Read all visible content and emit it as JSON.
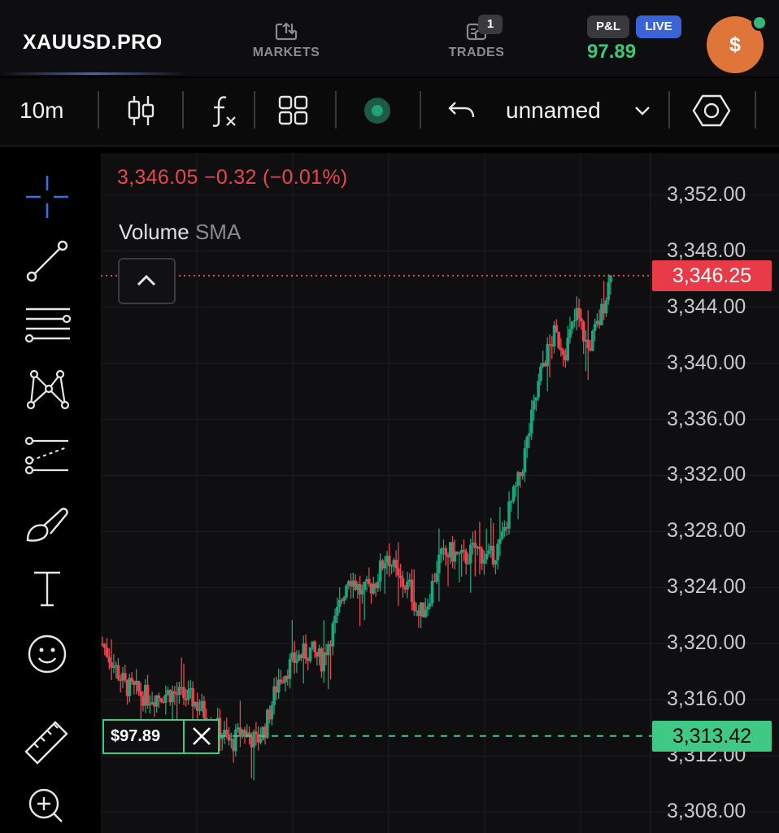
{
  "header": {
    "brand": "XAUUSD.PRO",
    "nav": [
      {
        "label": "MARKETS",
        "icon": "markets-icon"
      },
      {
        "label": "TRADES",
        "icon": "trades-icon",
        "badge": "1"
      }
    ],
    "pnl_label": "P&L",
    "live_label": "LIVE",
    "pnl_value": "97.89",
    "account_symbol": "$"
  },
  "toolbar": {
    "interval": "10m",
    "layout_name": "unnamed",
    "icons": [
      "candlestick-icon",
      "indicators-icon",
      "layouts-icon",
      "record-icon",
      "undo-icon",
      "chevron-down-icon",
      "settings-icon"
    ]
  },
  "left_tools": [
    "crosshair-icon",
    "trend-line-icon",
    "horizontal-lines-icon",
    "pattern-icon",
    "projection-icon",
    "brush-icon",
    "text-icon",
    "emoji-icon",
    "ruler-icon",
    "zoom-in-icon"
  ],
  "chart": {
    "price_info": "3,346.05  −0.32 (−0.01%)",
    "volume_label": "Volume",
    "sma_label": "SMA",
    "current_price_tag": "3,346.25",
    "entry_price_tag": "3,313.42",
    "position_label": "$97.89",
    "colors": {
      "up": "#1fa37a",
      "down": "#e8454f",
      "background": "#0f0f11"
    }
  },
  "chart_data": {
    "type": "candlestick",
    "y_tick_labels": [
      "3,352.00",
      "3,348.00",
      "3,344.00",
      "3,340.00",
      "3,336.00",
      "3,332.00",
      "3,328.00",
      "3,324.00",
      "3,320.00",
      "3,316.00",
      "3,312.00",
      "3,308.00"
    ],
    "y_ticks": [
      3352,
      3348,
      3344,
      3340,
      3336,
      3332,
      3328,
      3324,
      3320,
      3316,
      3312,
      3308
    ],
    "ylim": [
      3306.5,
      3355.0
    ],
    "current_price": 3346.25,
    "entry_price": 3313.42,
    "grid": true,
    "waypoints": [
      [
        0,
        3320.0
      ],
      [
        10,
        3317.0
      ],
      [
        20,
        3316.2
      ],
      [
        30,
        3316.5
      ],
      [
        40,
        3316.0
      ],
      [
        50,
        3314.2
      ],
      [
        57,
        3312.8
      ],
      [
        62,
        3313.8
      ],
      [
        68,
        3313.0
      ],
      [
        72,
        3314.0
      ],
      [
        78,
        3317.5
      ],
      [
        86,
        3319.0
      ],
      [
        92,
        3319.5
      ],
      [
        97,
        3318.8
      ],
      [
        103,
        3321.5
      ],
      [
        109,
        3325.0
      ],
      [
        115,
        3323.5
      ],
      [
        121,
        3324.5
      ],
      [
        126,
        3326.5
      ],
      [
        131,
        3324.5
      ],
      [
        136,
        3324.0
      ],
      [
        140,
        3322.0
      ],
      [
        144,
        3323.0
      ],
      [
        149,
        3326.0
      ],
      [
        154,
        3326.5
      ],
      [
        160,
        3326.0
      ],
      [
        165,
        3326.8
      ],
      [
        171,
        3326.0
      ],
      [
        176,
        3327.0
      ],
      [
        180,
        3329.5
      ],
      [
        185,
        3332.0
      ],
      [
        190,
        3336.0
      ],
      [
        195,
        3340.0
      ],
      [
        200,
        3342.0
      ],
      [
        205,
        3341.0
      ],
      [
        210,
        3343.5
      ],
      [
        215,
        3341.0
      ],
      [
        220,
        3343.0
      ],
      [
        225,
        3346.25
      ]
    ]
  }
}
